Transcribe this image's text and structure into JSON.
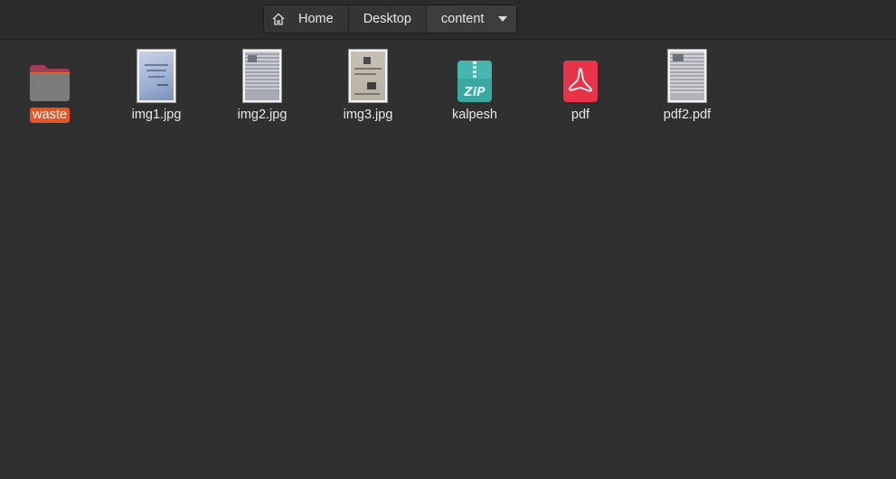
{
  "breadcrumb": {
    "items": [
      {
        "label": "Home",
        "icon": "home-icon"
      },
      {
        "label": "Desktop"
      },
      {
        "label": "content",
        "current": true
      }
    ]
  },
  "files": [
    {
      "name": "waste",
      "type": "folder",
      "selected": true
    },
    {
      "name": "img1.jpg",
      "type": "image"
    },
    {
      "name": "img2.jpg",
      "type": "image"
    },
    {
      "name": "img3.jpg",
      "type": "image"
    },
    {
      "name": "kalpesh",
      "type": "zip",
      "icon_text": "ZiP"
    },
    {
      "name": "pdf",
      "type": "pdf"
    },
    {
      "name": "pdf2.pdf",
      "type": "pdf-thumbnail"
    }
  ],
  "colors": {
    "background": "#303030",
    "selection": "#e95420",
    "zip": "#3aa8a0",
    "pdf": "#e8344a"
  }
}
